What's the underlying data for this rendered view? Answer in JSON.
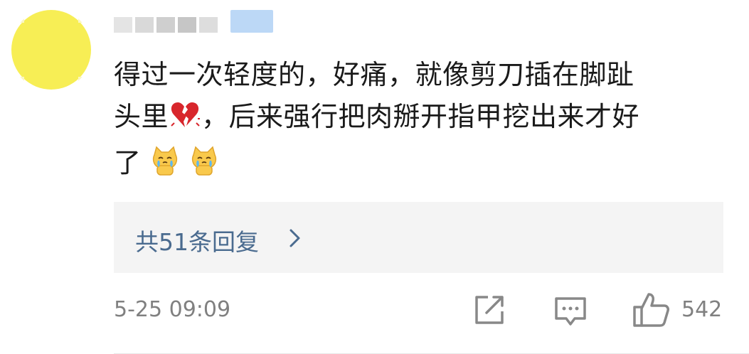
{
  "comment": {
    "author": {
      "avatar_color": "#f7ee55",
      "badge_color": "#bcd8f6"
    },
    "text_line1": "得过一次轻度的，好痛，就像剪刀插在脚趾",
    "text_line2_a": "头里",
    "text_line2_b": "，后来强行把肉掰开指甲挖出来才好",
    "text_line3": "了",
    "emojis": [
      "broken-heart",
      "crying-cat",
      "crying-cat"
    ]
  },
  "replies": {
    "label": "共51条回复",
    "chevron": "chevron-right-icon"
  },
  "footer": {
    "timestamp": "5-25 09:09",
    "like_count": "542",
    "icons": [
      "share-icon",
      "comment-icon",
      "thumbs-up-icon"
    ]
  },
  "colors": {
    "text": "#1a1a1a",
    "link": "#4a6b8f",
    "meta": "#808080",
    "reply_bg": "#f4f4f4"
  }
}
